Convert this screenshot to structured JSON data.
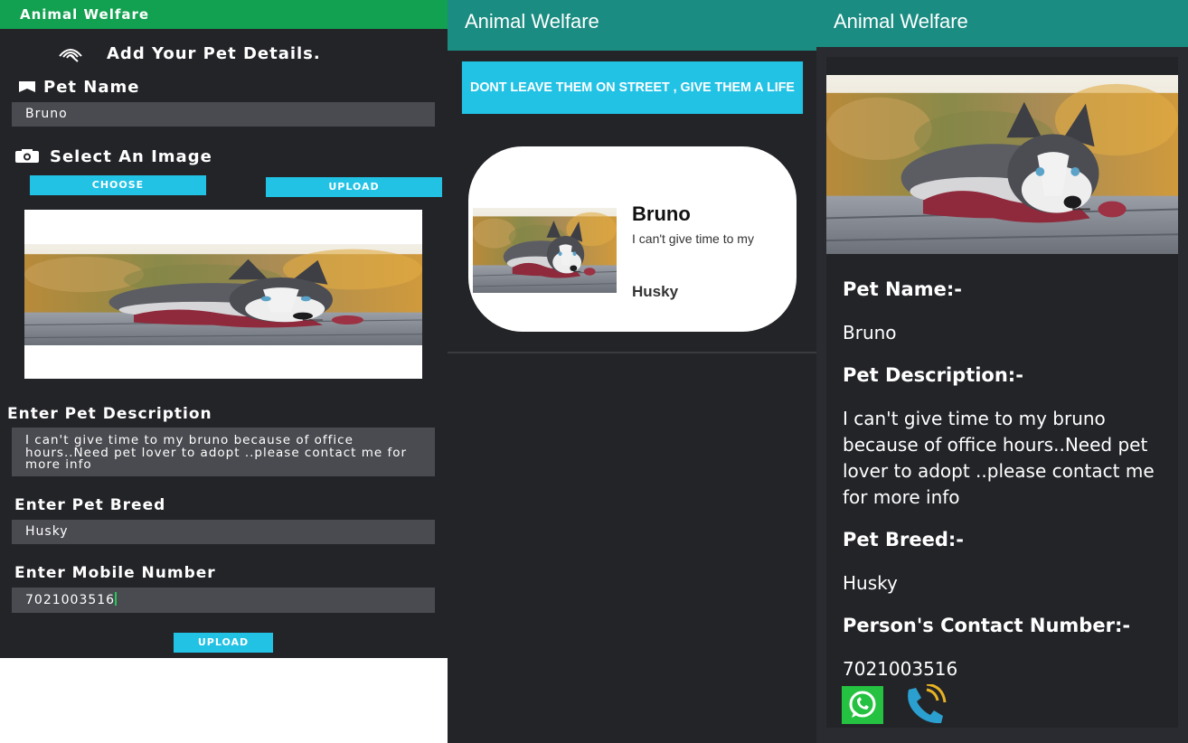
{
  "app": {
    "title": "Animal Welfare"
  },
  "colors": {
    "form_appbar": "#12a150",
    "teal_appbar": "#1a8c82",
    "accent_cyan": "#22c2e5",
    "dark_bg": "#232428",
    "field_bg": "#4a4b50",
    "whatsapp_green": "#25c140"
  },
  "form": {
    "heading": "Add Your Pet Details.",
    "heading_icon": "fingerprint-icon",
    "pet_name_label": "Pet Name",
    "pet_name_icon": "tag-icon",
    "pet_name_value": "Bruno",
    "image_label": "Select An Image",
    "image_icon": "camera-icon",
    "choose_button": "CHOOSE",
    "upload_image_button": "UPLOAD",
    "description_label": "Enter Pet Description",
    "description_value": "I can't give time to my bruno because of office hours..Need pet lover to adopt ..please contact me for more info",
    "breed_label": "Enter Pet Breed",
    "breed_value": "Husky",
    "mobile_label": "Enter Mobile Number",
    "mobile_value": "7021003516",
    "submit_button": "UPLOAD"
  },
  "list": {
    "banner": "DONT LEAVE THEM ON STREET , GIVE THEM A LIFE",
    "cards": [
      {
        "name": "Bruno",
        "description": "I can't give time to my",
        "breed": "Husky"
      }
    ]
  },
  "detail": {
    "name_label": "Pet Name:-",
    "name_value": "Bruno",
    "description_label": "Pet Description:-",
    "description_value": "I can't give time to my bruno because of office hours..Need pet lover to adopt ..please contact me for more info",
    "breed_label": "Pet Breed:-",
    "breed_value": "Husky",
    "contact_label": "Person's Contact Number:-",
    "contact_value": "7021003516",
    "whatsapp_icon": "whatsapp-icon",
    "call_icon": "phone-call-icon"
  }
}
